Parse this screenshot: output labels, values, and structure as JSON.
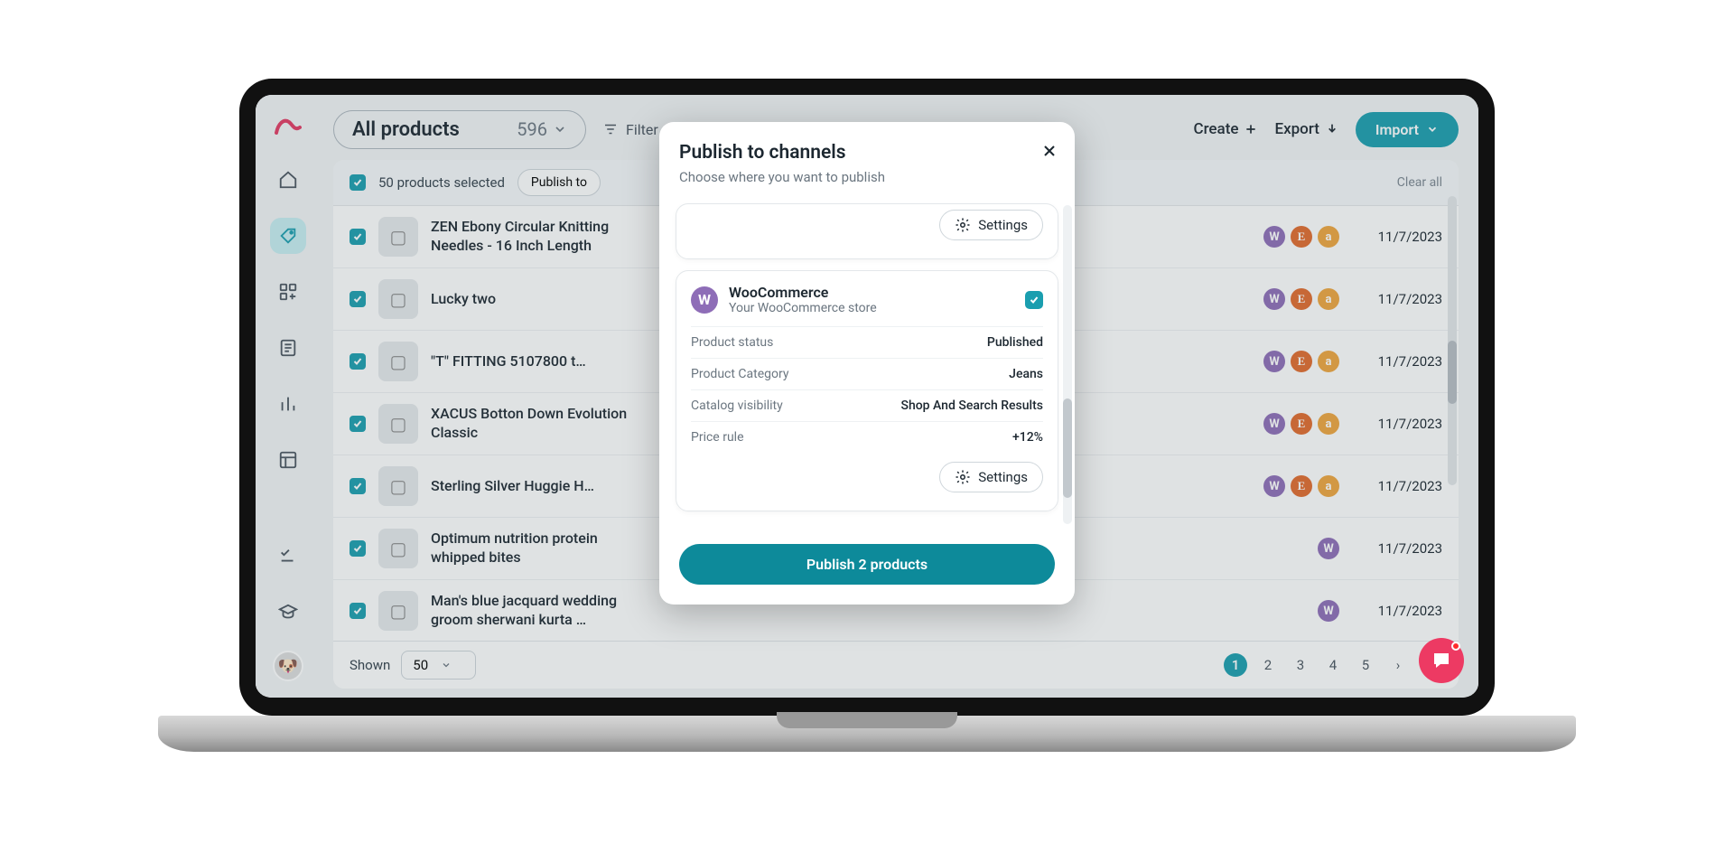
{
  "header": {
    "dropdown_label": "All products",
    "dropdown_count": "596",
    "filter_label": "Filter",
    "create_label": "Create",
    "export_label": "Export",
    "import_label": "Import"
  },
  "bulk": {
    "selected_text": "50 products selected",
    "publish_label": "Publish to",
    "clear_label": "Clear all"
  },
  "rows": [
    {
      "title": "ZEN Ebony Circular Knitting Needles - 16 Inch Length",
      "channels": [
        "W",
        "E",
        "a"
      ],
      "date": "11/7/2023"
    },
    {
      "title": "Lucky two",
      "channels": [
        "W",
        "E",
        "a"
      ],
      "date": "11/7/2023"
    },
    {
      "title": "\"T\" FITTING 5107800 t…",
      "channels": [
        "W",
        "E",
        "a"
      ],
      "date": "11/7/2023"
    },
    {
      "title": "XACUS Botton Down Evolution Classic",
      "channels": [
        "W",
        "E",
        "a"
      ],
      "date": "11/7/2023"
    },
    {
      "title": "Sterling Silver Huggie H…",
      "channels": [
        "W",
        "E",
        "a"
      ],
      "date": "11/7/2023"
    },
    {
      "title": "Optimum nutrition protein whipped bites",
      "channels": [
        "W"
      ],
      "date": "11/7/2023"
    },
    {
      "title": "Man's blue jacquard wedding groom sherwani kurta …",
      "channels": [
        "W"
      ],
      "date": "11/7/2023"
    }
  ],
  "footer": {
    "shown_label": "Shown",
    "shown_value": "50",
    "pages": [
      "1",
      "2",
      "3",
      "4",
      "5"
    ]
  },
  "modal": {
    "title": "Publish to channels",
    "subtitle": "Choose where you want to publish",
    "settings_label": "Settings",
    "channel": {
      "name": "WooCommerce",
      "subtitle": "Your WooCommerce store",
      "kv": [
        {
          "k": "Product status",
          "v": "Published"
        },
        {
          "k": "Product Category",
          "v": "Jeans"
        },
        {
          "k": "Catalog visibility",
          "v": "Shop And Search Results"
        },
        {
          "k": "Price rule",
          "v": "+12%"
        }
      ]
    },
    "cta_label": "Publish 2 products"
  }
}
